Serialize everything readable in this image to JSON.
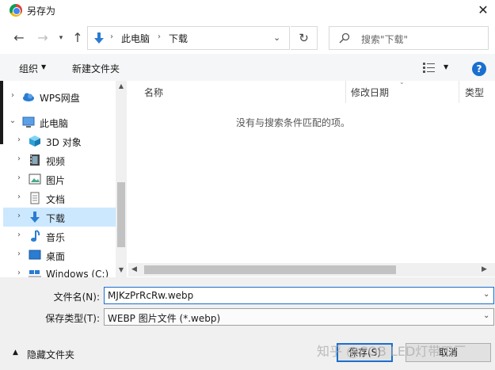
{
  "window": {
    "title": "另存为",
    "close_glyph": "✕"
  },
  "nav": {
    "back_glyph": "←",
    "forward_glyph": "→",
    "recent_glyph": "▾",
    "up_glyph": "↑",
    "breadcrumb": [
      "此电脑",
      "下载"
    ],
    "breadcrumb_sep": "›",
    "dropdown_glyph": "⌄",
    "refresh_glyph": "↻",
    "search_placeholder": "搜索\"下载\""
  },
  "toolbar": {
    "organize": "组织",
    "organize_arrow": "▼",
    "new_folder": "新建文件夹",
    "view_arrow": "▼",
    "help": "?"
  },
  "sidebar": {
    "items": [
      {
        "label": "WPS网盘",
        "chevron": "›",
        "icon": "cloud-icon"
      },
      {
        "label": "此电脑",
        "chevron": "⌄",
        "icon": "computer-icon"
      },
      {
        "label": "3D 对象",
        "chevron": "›",
        "icon": "cube-icon"
      },
      {
        "label": "视频",
        "chevron": "›",
        "icon": "video-icon"
      },
      {
        "label": "图片",
        "chevron": "›",
        "icon": "picture-icon"
      },
      {
        "label": "文档",
        "chevron": "›",
        "icon": "document-icon"
      },
      {
        "label": "下载",
        "chevron": "›",
        "icon": "download-icon"
      },
      {
        "label": "音乐",
        "chevron": "›",
        "icon": "music-icon"
      },
      {
        "label": "桌面",
        "chevron": "›",
        "icon": "desktop-icon"
      },
      {
        "label": "Windows (C:)",
        "chevron": "›",
        "icon": "drive-icon"
      }
    ],
    "scroll_up": "▲",
    "scroll_down": "▼"
  },
  "content": {
    "columns": [
      "名称",
      "修改日期",
      "类型"
    ],
    "sort_glyph": "⌄",
    "empty_message": "没有与搜索条件匹配的项。",
    "hscroll_left": "◀",
    "hscroll_right": "▶"
  },
  "form": {
    "filename_label": "文件名(N):",
    "filename_value": "MJKzPrRcRw.webp",
    "filetype_label": "保存类型(T):",
    "filetype_value": "WEBP 图片文件 (*.webp)",
    "dropdown_glyph": "⌄",
    "hide_folders_arrow": "▲",
    "hide_folders": "隐藏文件夹",
    "save_button": "保存(S)",
    "cancel_button": "取消"
  },
  "watermark": "知乎 @COB LED灯带工厂",
  "colors": {
    "accent": "#1a6fce",
    "selection": "#cce8ff",
    "panel": "#f0f0f0"
  }
}
